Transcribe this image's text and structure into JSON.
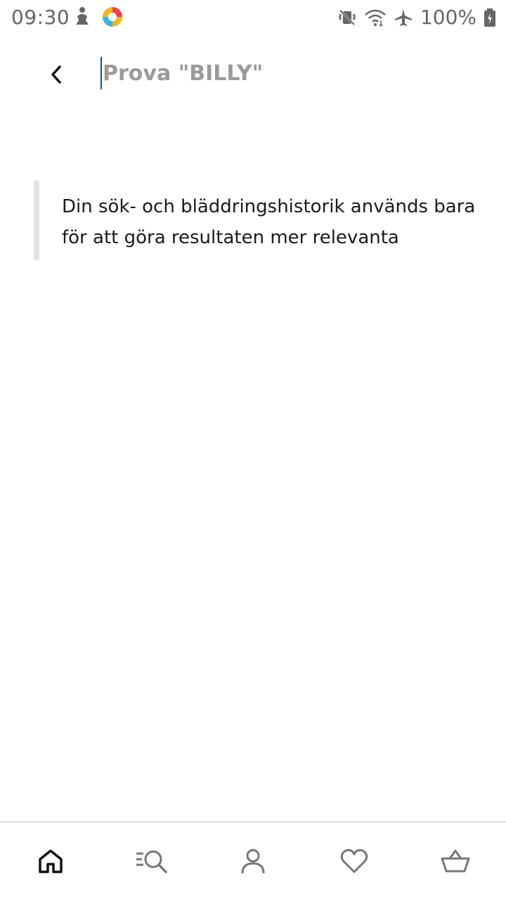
{
  "status_bar": {
    "time": "09:30",
    "battery": "100%",
    "icons": [
      "notification-figure-icon",
      "app-logo-icon",
      "vibrate-icon",
      "wifi-icon",
      "airplane-icon",
      "battery-charging-icon"
    ]
  },
  "search": {
    "placeholder": "Prova \"BILLY\"",
    "value": ""
  },
  "notice": {
    "text": "Din sök- och bläddringshistorik används bara för att göra resultaten mer relevanta"
  },
  "bottom_nav": {
    "items": [
      {
        "icon": "home-icon",
        "active": true
      },
      {
        "icon": "search-list-icon",
        "active": false
      },
      {
        "icon": "profile-icon",
        "active": false
      },
      {
        "icon": "heart-icon",
        "active": false
      },
      {
        "icon": "basket-icon",
        "active": false
      }
    ]
  },
  "colors": {
    "accent": "#0058a3",
    "text": "#1a1a1a",
    "muted": "#9a9a9a",
    "divider": "#dcdcdc"
  }
}
